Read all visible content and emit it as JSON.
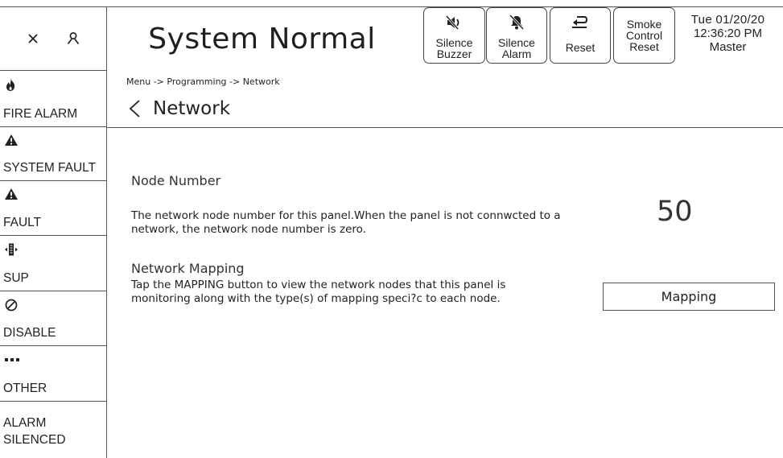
{
  "header": {
    "status_title": "System Normal",
    "buttons": [
      {
        "line1": "Silence",
        "line2": "Buzzer",
        "icon": "speaker-mute-icon"
      },
      {
        "line1": "Silence",
        "line2": "Alarm",
        "icon": "bell-off-icon"
      },
      {
        "line1": "Reset",
        "icon": "reset-arrow-icon"
      },
      {
        "line1": "Smoke",
        "line2": "Control",
        "line3": "Reset"
      }
    ],
    "date": "Tue 01/20/20",
    "time": "12:36:20 PM",
    "role": "Master"
  },
  "top_icons": [
    "close-icon",
    "user-icon"
  ],
  "sidebar": {
    "items": [
      {
        "label": "FIRE ALARM",
        "icon": "flame-icon"
      },
      {
        "label": "SYSTEM FAULT",
        "icon": "warning-icon"
      },
      {
        "label": "FAULT",
        "icon": "warning-icon"
      },
      {
        "label": "SUP",
        "icon": "supervisory-icon"
      },
      {
        "label": "DISABLE",
        "icon": "disable-icon"
      },
      {
        "label": "OTHER",
        "icon": "more-icon"
      },
      {
        "label": "ALARM SILENCED"
      }
    ]
  },
  "main": {
    "breadcrumb": "Menu  -> Programming  -> Network",
    "title": "Network",
    "node_heading": "Node Number",
    "node_desc_1": "The network node number for this panel.When the panel is not connwcted to a",
    "node_desc_2": "network, the network node number is zero.",
    "node_value": "50",
    "mapping_heading": "Network Mapping",
    "mapping_desc_1": "Tap the MAPPING button to view the network nodes that this panel is",
    "mapping_desc_2": "monitoring along with the type(s) of mapping speci?c to each node.",
    "mapping_button": "Mapping"
  }
}
